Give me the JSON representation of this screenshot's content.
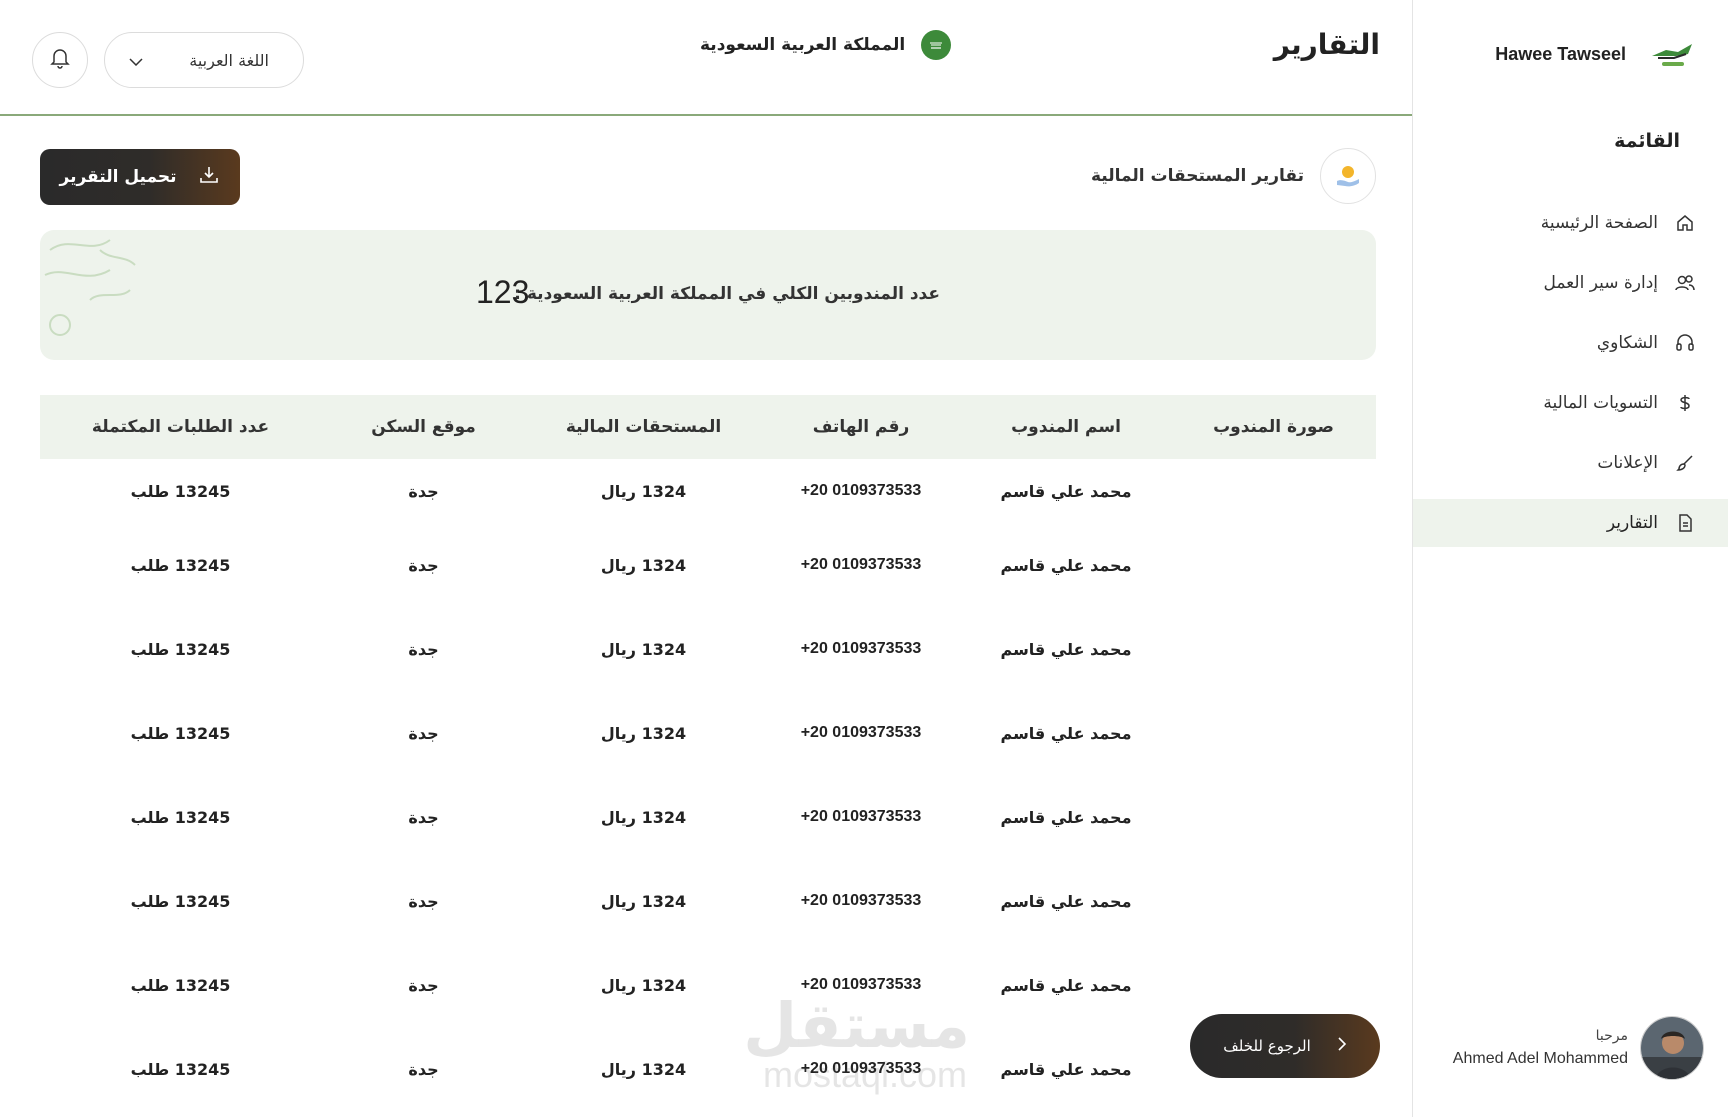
{
  "sidebar": {
    "brand_name": "Hawee Tawseel",
    "menu_title": "القائمة",
    "items": [
      {
        "label": "الصفحة الرئيسية",
        "icon": "home-icon"
      },
      {
        "label": "إدارة سير العمل",
        "icon": "users-icon"
      },
      {
        "label": "الشكاوي",
        "icon": "headset-icon"
      },
      {
        "label": "التسويات المالية",
        "icon": "dollar-icon"
      },
      {
        "label": "الإعلانات",
        "icon": "brush-icon"
      },
      {
        "label": "التقارير",
        "icon": "document-icon",
        "active": true
      }
    ],
    "profile": {
      "greeting": "مرحبا",
      "name": "Ahmed Adel Mohammed"
    }
  },
  "header": {
    "title": "التقارير",
    "country": "المملكة العربية السعودية",
    "language": "اللغة العربية"
  },
  "section": {
    "title": "تقارير المستحقات المالية",
    "download_label": "تحميل التقرير"
  },
  "summary": {
    "label": "عدد المندوبين الكلي في المملكة العربية السعودية :",
    "value": "123"
  },
  "table": {
    "headers": [
      "صورة المندوب",
      "اسم المندوب",
      "رقم الهاتف",
      "المستحقات المالية",
      "موقع السكن",
      "عدد الطلبات المكتملة"
    ],
    "rows": [
      [
        "",
        "محمد علي قاسم",
        "+20 0109373533",
        "1324 ريال",
        "جدة",
        "13245 طلب"
      ],
      [
        "",
        "محمد علي قاسم",
        "+20 0109373533",
        "1324 ريال",
        "جدة",
        "13245 طلب"
      ],
      [
        "",
        "محمد علي قاسم",
        "+20 0109373533",
        "1324 ريال",
        "جدة",
        "13245 طلب"
      ],
      [
        "",
        "محمد علي قاسم",
        "+20 0109373533",
        "1324 ريال",
        "جدة",
        "13245 طلب"
      ],
      [
        "",
        "محمد علي قاسم",
        "+20 0109373533",
        "1324 ريال",
        "جدة",
        "13245 طلب"
      ],
      [
        "",
        "محمد علي قاسم",
        "+20 0109373533",
        "1324 ريال",
        "جدة",
        "13245 طلب"
      ],
      [
        "",
        "محمد علي قاسم",
        "+20 0109373533",
        "1324 ريال",
        "جدة",
        "13245 طلب"
      ],
      [
        "",
        "محمد علي قاسم",
        "+20 0109373533",
        "1324 ريال",
        "جدة",
        "13245 طلب"
      ]
    ]
  },
  "back_label": "الرجوع للخلف",
  "watermark": {
    "ar": "مستقل",
    "en": "mostaql.com"
  },
  "colors": {
    "accent_green": "#eef3ec",
    "divider_green": "#8aa97a",
    "button_dark": "#2f2c29",
    "button_brown": "#5a3a1e"
  }
}
